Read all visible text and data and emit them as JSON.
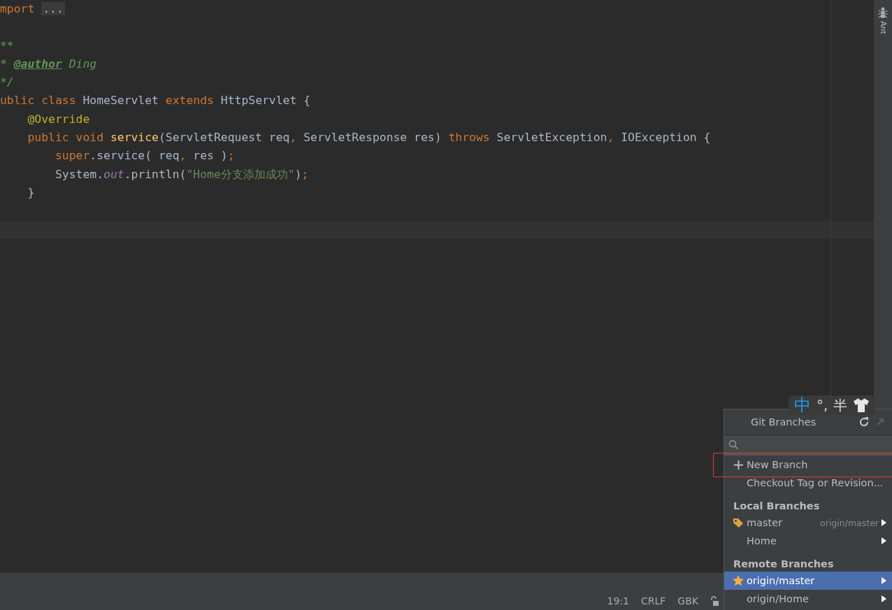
{
  "editor": {
    "lines": [
      {
        "tokens": [
          {
            "kind": "keyword",
            "text": "mport "
          },
          {
            "kind": "fold",
            "text": "..."
          }
        ]
      },
      {
        "kind": "blank"
      },
      {
        "tokens": [
          {
            "kind": "comment",
            "text": "**"
          }
        ]
      },
      {
        "tokens": [
          {
            "kind": "comment",
            "text": "* "
          },
          {
            "kind": "doctag",
            "text": "@author"
          },
          {
            "kind": "comment",
            "text": " Ding"
          }
        ]
      },
      {
        "tokens": [
          {
            "kind": "comment",
            "text": "*/"
          }
        ]
      },
      {
        "tokens": [
          {
            "kind": "keyword",
            "text": "ublic class "
          },
          {
            "kind": "plain",
            "text": "HomeServlet "
          },
          {
            "kind": "keyword",
            "text": "extends "
          },
          {
            "kind": "plain",
            "text": "HttpServlet {"
          }
        ]
      },
      {
        "tokens": [
          {
            "kind": "annotation",
            "text": "    @Override"
          }
        ]
      },
      {
        "tokens": [
          {
            "kind": "keyword",
            "text": "    public void "
          },
          {
            "kind": "method",
            "text": "service"
          },
          {
            "kind": "plain",
            "text": "(ServletRequest req"
          },
          {
            "kind": "keyword",
            "text": ", "
          },
          {
            "kind": "plain",
            "text": "ServletResponse res) "
          },
          {
            "kind": "keyword",
            "text": "throws "
          },
          {
            "kind": "plain",
            "text": "ServletException"
          },
          {
            "kind": "keyword",
            "text": ", "
          },
          {
            "kind": "plain",
            "text": "IOException {"
          }
        ]
      },
      {
        "tokens": [
          {
            "kind": "keyword",
            "text": "        super"
          },
          {
            "kind": "plain",
            "text": ".service( req"
          },
          {
            "kind": "keyword",
            "text": ", "
          },
          {
            "kind": "plain",
            "text": "res )"
          },
          {
            "kind": "keyword",
            "text": ";"
          }
        ]
      },
      {
        "tokens": [
          {
            "kind": "plain",
            "text": "        System."
          },
          {
            "kind": "field",
            "text": "out"
          },
          {
            "kind": "plain",
            "text": ".println("
          },
          {
            "kind": "string",
            "text": "\"Home分支添加成功\""
          },
          {
            "kind": "plain",
            "text": ")"
          },
          {
            "kind": "keyword",
            "text": ";"
          }
        ]
      },
      {
        "tokens": [
          {
            "kind": "plain",
            "text": "    }"
          }
        ]
      },
      {
        "kind": "blank"
      },
      {
        "kind": "caret"
      }
    ]
  },
  "right_toolbar": {
    "items": [
      {
        "label": "Ant"
      }
    ]
  },
  "status_bar": {
    "items": [
      "19:1",
      "CRLF",
      "GBK"
    ]
  },
  "ime_toolbar": {
    "mode": "中",
    "punctuation": "°,",
    "width": "半"
  },
  "git_branches_popup": {
    "title": "Git Branches",
    "items": [
      {
        "kind": "create",
        "label": "New Branch",
        "selected": false,
        "highlighted_frame": true
      },
      {
        "kind": "action",
        "label": "Checkout Tag or Revision...",
        "selected": false,
        "highlighted_frame": false
      },
      {
        "kind": "header",
        "label": "Local Branches"
      },
      {
        "kind": "branch",
        "label": "master",
        "tracking": "origin/master",
        "current": true,
        "favorite": false,
        "selected": false
      },
      {
        "kind": "branch",
        "label": "Home",
        "current": false,
        "favorite": false,
        "selected": false
      },
      {
        "kind": "header",
        "label": "Remote Branches"
      },
      {
        "kind": "branch",
        "label": "origin/master",
        "current": false,
        "favorite": true,
        "selected": true
      },
      {
        "kind": "branch",
        "label": "origin/Home",
        "current": false,
        "favorite": false,
        "selected": false
      }
    ]
  }
}
